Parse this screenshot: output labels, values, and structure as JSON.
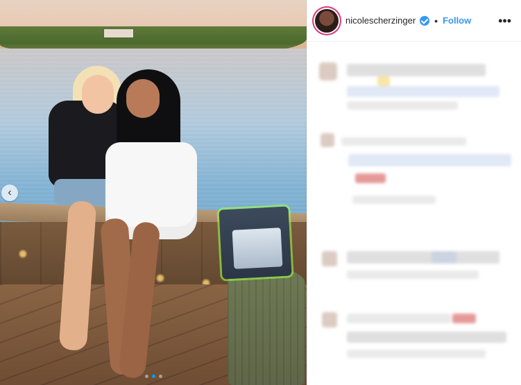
{
  "post": {
    "header": {
      "username": "nicolescherzinger",
      "separator": "•",
      "follow_label": "Follow",
      "more_label": "•••",
      "verified_icon": "verified-badge-icon",
      "accent_color": "#3897f0"
    },
    "media": {
      "carousel": {
        "prev_icon": "chevron-left-icon",
        "prev_label": "‹",
        "active_index": 2,
        "total": 3,
        "active_dot_color": "#00a0ff"
      }
    }
  }
}
